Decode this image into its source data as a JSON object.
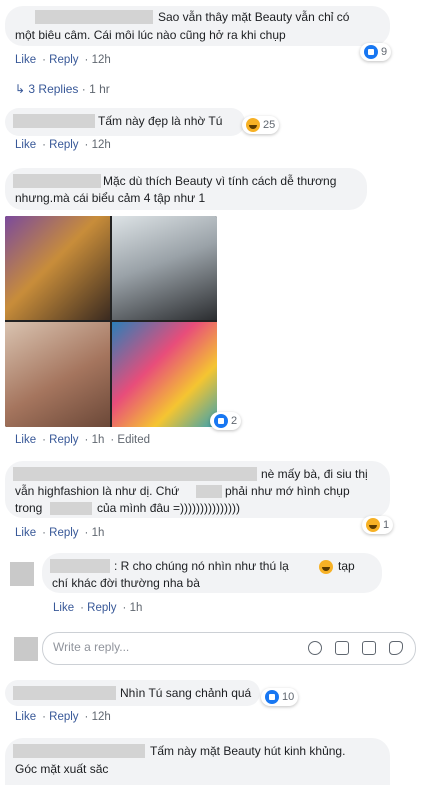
{
  "comments": [
    {
      "text_line1": "Sao vẫn thây mặt Beauty vẫn chỉ có",
      "text_line2": "một biêu câm. Cái môi lúc nào cũng hở ra khi chụp",
      "reaction_count": "9",
      "like": "Like",
      "reply": "Reply",
      "time": "12h"
    },
    {
      "replies_label": "3 Replies",
      "replies_time": "1 hr"
    },
    {
      "text": "Tấm này đẹp là nhờ Tú",
      "reaction_count": "25",
      "like": "Like",
      "reply": "Reply",
      "time": "12h"
    },
    {
      "text_line1": "Mặc dù thích Beauty vì tính cách dễ thương",
      "text_line2": "nhưng.mà cái biểu cảm 4 tập như 1",
      "reaction_count": "2",
      "like": "Like",
      "reply": "Reply",
      "time": "1h",
      "edited": "Edited"
    },
    {
      "text_line1": "nè mấy bà, đi siu thị",
      "text_line2a": "vẫn highfashion là như dị. Chứ",
      "text_line2b": "phải như mớ hình chụp",
      "text_line3a": "trong",
      "text_line3b": "của mình đâu =)))))))))))))))",
      "reaction_count": "1",
      "like": "Like",
      "reply": "Reply",
      "time": "1h"
    },
    {
      "text_line1": ": R cho chúng nó nhìn như thú lạ",
      "text_line1b": "tạp",
      "text_line2": "chí khác đời thường nha bà",
      "like": "Like",
      "reply": "Reply",
      "time": "1h"
    },
    {
      "text": "Nhìn Tú sang chảnh quá",
      "reaction_count": "10",
      "like": "Like",
      "reply": "Reply",
      "time": "12h"
    },
    {
      "text_line1": "Tấm này mặt Beauty hút kinh khủng.",
      "text_line2": "Góc mặt xuất săc"
    }
  ],
  "reply_box": {
    "placeholder": "Write a reply..."
  },
  "icons": [
    "like-icon",
    "haha-icon",
    "reply-arrow-icon",
    "camera-icon",
    "emoji-icon",
    "gif-icon",
    "sticker-icon"
  ],
  "colors": {
    "bubble": "#f2f3f5",
    "link": "#385898",
    "meta": "#606770",
    "like_blue": "#1877f2"
  }
}
